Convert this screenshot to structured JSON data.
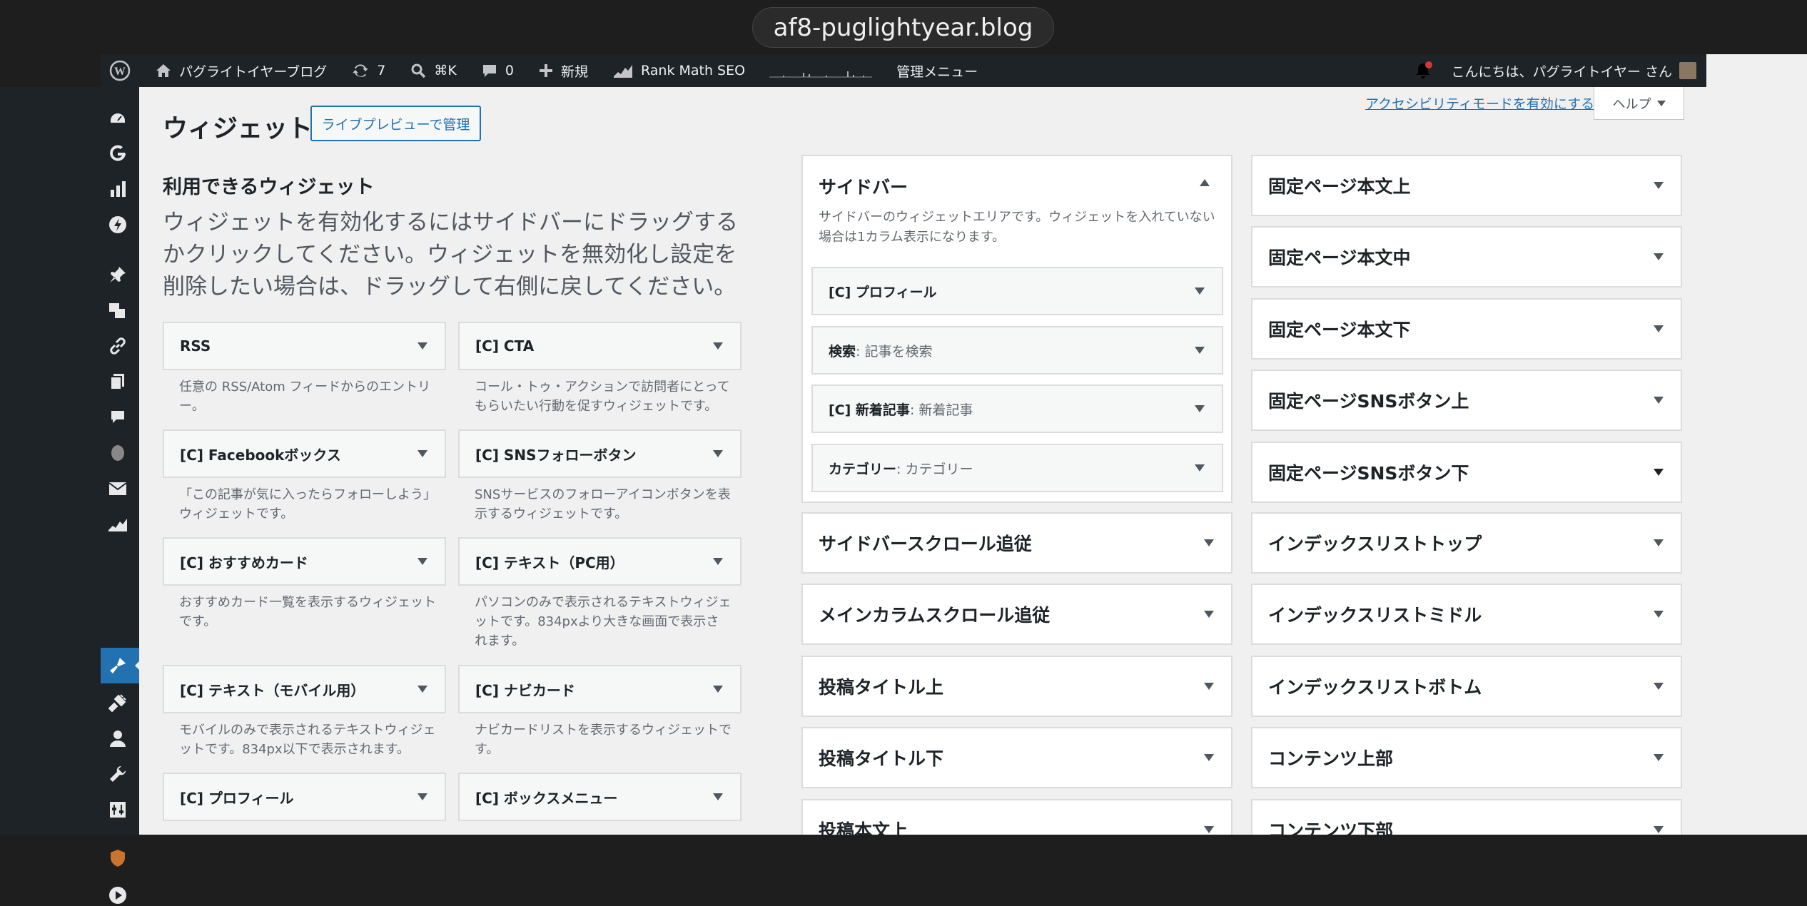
{
  "browser": {
    "url": "af8-puglightyear.blog"
  },
  "adminbar": {
    "site_name": "パグライトイヤーブログ",
    "updates_count": "7",
    "search_shortcut": "⌘K",
    "comments_count": "0",
    "new_label": "新規",
    "rankmath_label": "Rank Math SEO",
    "admin_menu_label": "管理メニュー",
    "greeting": "こんにちは、パグライトイヤー さん"
  },
  "header": {
    "title": "ウィジェット",
    "live_preview_button": "ライブプレビューで管理",
    "a11y_link": "アクセシビリティモードを有効にする",
    "help_button": "ヘルプ"
  },
  "available": {
    "title": "利用できるウィジェット",
    "description": "ウィジェットを有効化するにはサイドバーにドラッグするかクリックしてください。ウィジェットを無効化し設定を削除したい場合は、ドラッグして右側に戻してください。",
    "widgets": [
      {
        "name": "RSS",
        "desc": "任意の RSS/Atom フィードからのエントリー。"
      },
      {
        "name": "[C] CTA",
        "desc": "コール・トゥ・アクションで訪問者にとってもらいたい行動を促すウィジェットです。"
      },
      {
        "name": "[C] Facebookボックス",
        "desc": "「この記事が気に入ったらフォローしよう」ウィジェットです。"
      },
      {
        "name": "[C] SNSフォローボタン",
        "desc": "SNSサービスのフォローアイコンボタンを表示するウィジェットです。"
      },
      {
        "name": "[C] おすすめカード",
        "desc": "おすすめカード一覧を表示するウィジェットです。"
      },
      {
        "name": "[C] テキスト（PC用）",
        "desc": "パソコンのみで表示されるテキストウィジェットです。834pxより大きな画面で表示されます。"
      },
      {
        "name": "[C] テキスト（モバイル用）",
        "desc": "モバイルのみで表示されるテキストウィジェットです。834px以下で表示されます。"
      },
      {
        "name": "[C] ナビカード",
        "desc": "ナビカードリストを表示するウィジェットです。"
      },
      {
        "name": "[C] プロフィール",
        "desc": ""
      },
      {
        "name": "[C] ボックスメニュー",
        "desc": ""
      }
    ]
  },
  "sidebar_area": {
    "title": "サイドバー",
    "description": "サイドバーのウィジェットエリアです。ウィジェットを入れていない場合は1カラム表示になります。",
    "widgets": [
      {
        "name": "[C] プロフィール",
        "sub": ""
      },
      {
        "name": "検索",
        "sub": ": 記事を検索"
      },
      {
        "name": "[C] 新着記事",
        "sub": ": 新着記事"
      },
      {
        "name": "カテゴリー",
        "sub": ": カテゴリー"
      }
    ]
  },
  "areas_col1": [
    "サイドバースクロール追従",
    "メインカラムスクロール追従",
    "投稿タイトル上",
    "投稿タイトル下",
    "投稿本文上"
  ],
  "areas_col2": [
    "固定ページ本文上",
    "固定ページ本文中",
    "固定ページ本文下",
    "固定ページSNSボタン上",
    "固定ページSNSボタン下",
    "インデックスリストトップ",
    "インデックスリストミドル",
    "インデックスリストボトム",
    "コンテンツ上部",
    "コンテンツ下部"
  ]
}
